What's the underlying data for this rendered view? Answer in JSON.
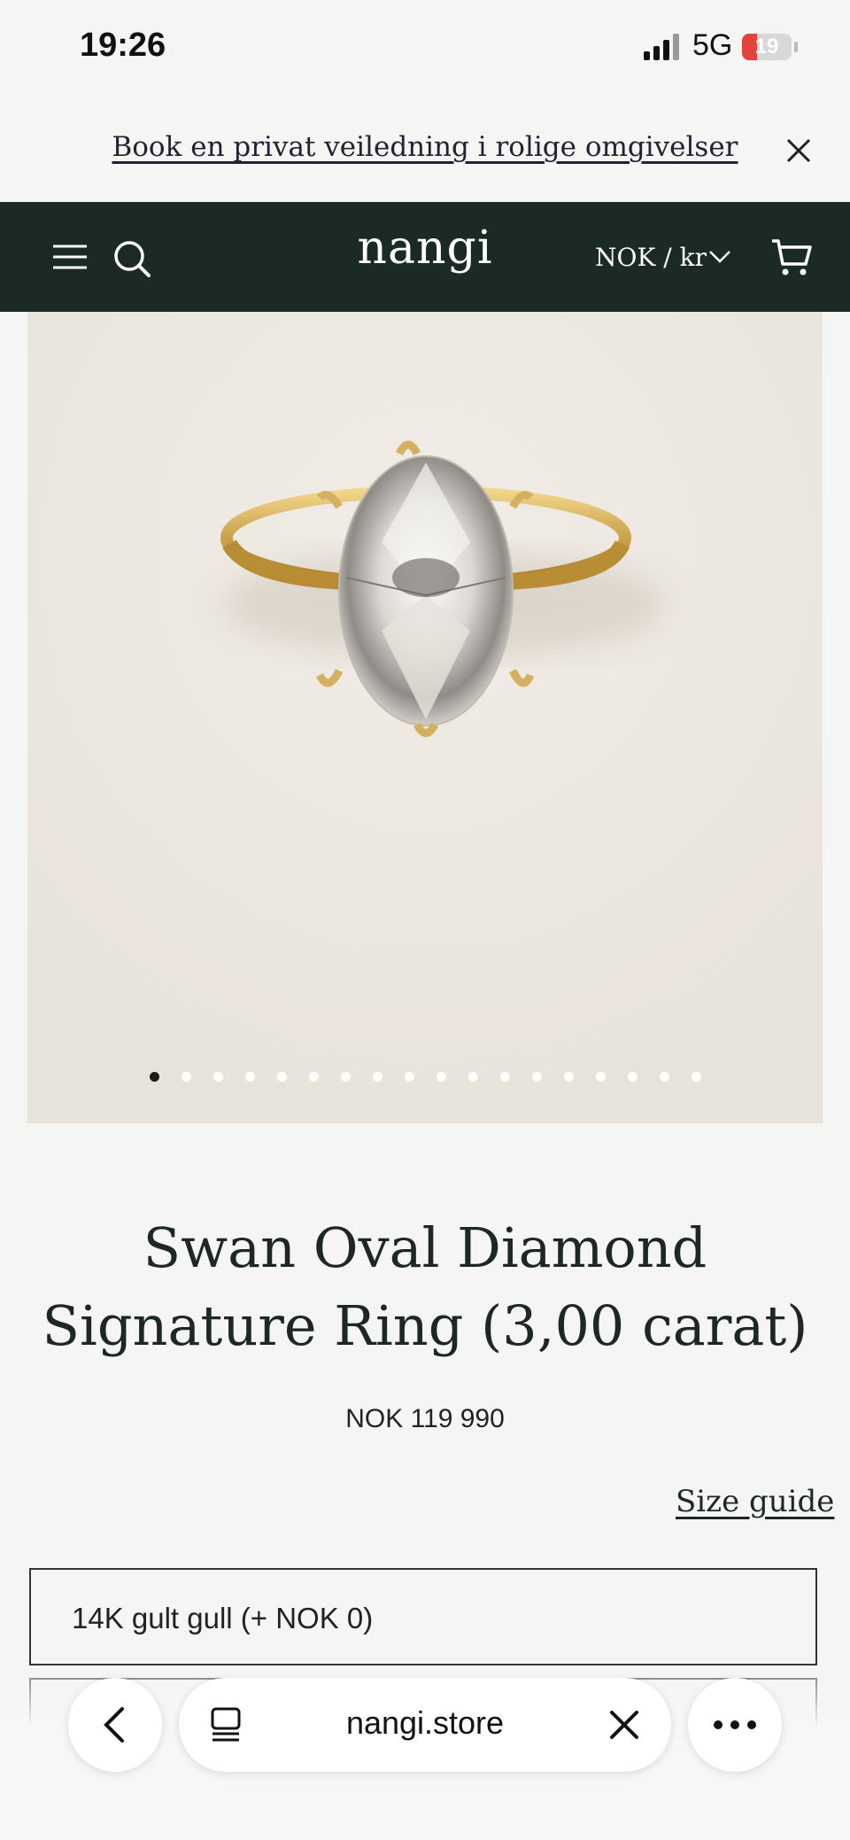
{
  "status": {
    "time": "19:26",
    "network": "5G",
    "battery": "19"
  },
  "announcement": {
    "text": "Book en privat veiledning i rolige omgivelser"
  },
  "nav": {
    "logo": "nangi",
    "currency": "NOK / kr",
    "icons": [
      "menu-icon",
      "search-icon",
      "chevron-down-icon",
      "cart-icon"
    ]
  },
  "gallery": {
    "image_count": 18,
    "active_index": 0
  },
  "product": {
    "title": "Swan Oval Diamond Signature Ring (3,00 carat)",
    "price": "NOK 119 990",
    "size_guide": "Size guide",
    "options": [
      "14K gult gull (+ NOK 0)",
      ""
    ]
  },
  "browser": {
    "url": "nangi.store"
  },
  "colors": {
    "nav_bg": "#1b2a25",
    "page_bg": "#f5f5f3",
    "image_bg": "#ebe7df",
    "gold": "#c9a24a"
  }
}
